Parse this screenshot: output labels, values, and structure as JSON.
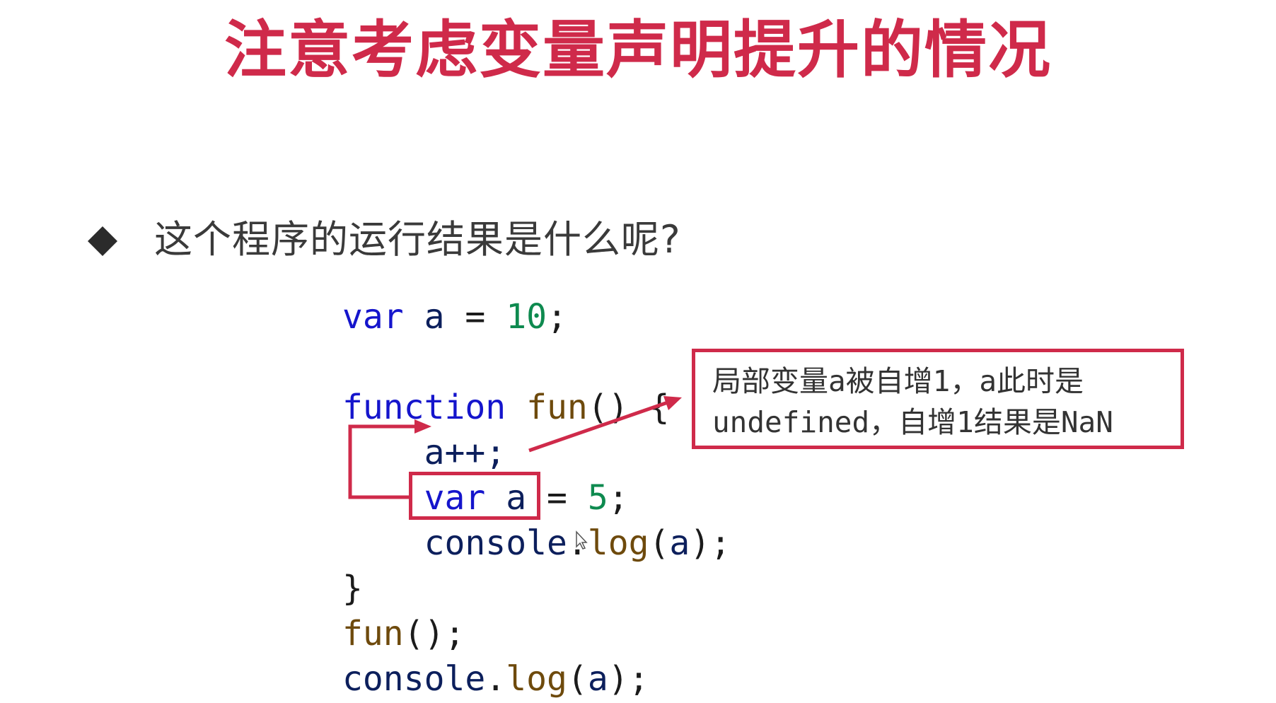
{
  "title": "注意考虑变量声明提升的情况",
  "question": "这个程序的运行结果是什么呢?",
  "colors": {
    "accent": "#cf2a4a",
    "keyword": "#1515cc",
    "identifier": "#0c1f5c",
    "number": "#0e8a4f",
    "function": "#6e4a0c"
  },
  "code": {
    "line1": {
      "kw": "var",
      "id": "a",
      "op": "=",
      "num": "10",
      "end": ";"
    },
    "line3": {
      "kw": "function",
      "fn": "fun",
      "rest": "() {"
    },
    "line4": {
      "text": "a++;"
    },
    "line5": {
      "kw": "var",
      "id": "a",
      "op": "=",
      "num": "5",
      "end": ";"
    },
    "line6": {
      "obj": "console",
      "dot": ".",
      "fn": "log",
      "open": "(",
      "arg": "a",
      "close": ");"
    },
    "line7": {
      "text": "}"
    },
    "line8": {
      "fn": "fun",
      "rest": "();"
    },
    "line9": {
      "obj": "console",
      "dot": ".",
      "fn": "log",
      "open": "(",
      "arg": "a",
      "close": ");"
    }
  },
  "callout": {
    "line1": "局部变量a被自增1，a此时是",
    "line2": "undefined，自增1结果是NaN"
  }
}
